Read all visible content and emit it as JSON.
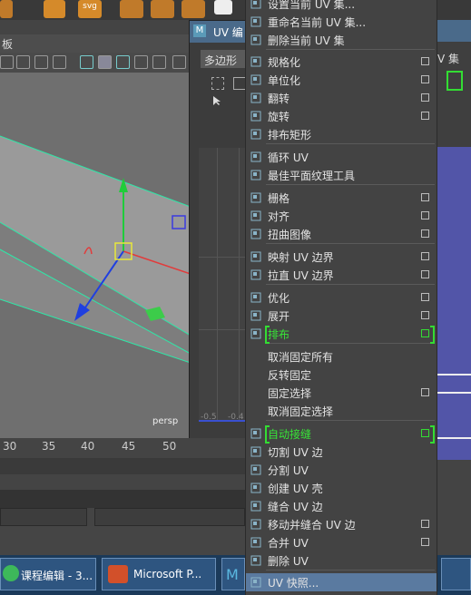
{
  "viewport": {
    "panel_label": "板",
    "camera_label": "persp",
    "timeline_ticks": [
      "30",
      "35",
      "40",
      "45",
      "50"
    ]
  },
  "uv_window": {
    "title": "UV 编",
    "tab_label": "多边形",
    "axis_labels": [
      "-0.5",
      "-0.4"
    ]
  },
  "right_panel": {
    "label": "V 集"
  },
  "menu": {
    "items": [
      {
        "label": "设置当前 UV 集...",
        "icon": "uv-set-icon",
        "check": false
      },
      {
        "label": "重命名当前 UV 集...",
        "icon": "rename-uv-icon",
        "check": false
      },
      {
        "label": "删除当前 UV 集",
        "icon": "delete-uv-icon",
        "check": false
      },
      {
        "label": "规格化",
        "icon": "normalize-icon",
        "check": true
      },
      {
        "label": "单位化",
        "icon": "unitize-icon",
        "check": true
      },
      {
        "label": "翻转",
        "icon": "flip-icon",
        "check": true
      },
      {
        "label": "旋转",
        "icon": "rotate-icon",
        "check": true
      },
      {
        "label": "排布矩形",
        "icon": "rect-layout-icon",
        "check": false
      },
      {
        "label": "循环 UV",
        "icon": "cycle-uv-icon",
        "check": false
      },
      {
        "label": "最佳平面纹理工具",
        "icon": "best-plane-icon",
        "check": false
      },
      {
        "label": "栅格",
        "icon": "grid-icon",
        "check": true
      },
      {
        "label": "对齐",
        "icon": "align-icon",
        "check": true
      },
      {
        "label": "扭曲图像",
        "icon": "warp-icon",
        "check": true
      },
      {
        "label": "映射 UV 边界",
        "icon": "map-border-icon",
        "check": true
      },
      {
        "label": "拉直 UV 边界",
        "icon": "straighten-border-icon",
        "check": true
      },
      {
        "label": "优化",
        "icon": "optimize-icon",
        "check": true
      },
      {
        "label": "展开",
        "icon": "unfold-icon",
        "check": true
      },
      {
        "label": "排布",
        "icon": "layout-icon",
        "check": true,
        "highlight": true
      },
      {
        "label": "取消固定所有",
        "icon": "",
        "check": false
      },
      {
        "label": "反转固定",
        "icon": "",
        "check": false
      },
      {
        "label": "固定选择",
        "icon": "",
        "check": true
      },
      {
        "label": "取消固定选择",
        "icon": "",
        "check": false
      },
      {
        "label": "自动接缝",
        "icon": "auto-seam-icon",
        "check": true,
        "highlight": true
      },
      {
        "label": "切割 UV 边",
        "icon": "cut-uv-icon",
        "check": false
      },
      {
        "label": "分割 UV",
        "icon": "split-uv-icon",
        "check": false
      },
      {
        "label": "创建 UV 壳",
        "icon": "create-shell-icon",
        "check": false
      },
      {
        "label": "缝合 UV 边",
        "icon": "sew-uv-icon",
        "check": false
      },
      {
        "label": "移动并缝合 UV 边",
        "icon": "move-sew-icon",
        "check": true
      },
      {
        "label": "合并 UV",
        "icon": "merge-uv-icon",
        "check": true
      },
      {
        "label": "删除 UV",
        "icon": "delete-icon",
        "check": false
      },
      {
        "label": "UV 快照...",
        "icon": "snapshot-icon",
        "check": false,
        "selected": true
      }
    ]
  },
  "taskbar": {
    "items": [
      "课程编辑 - 3...",
      "Microsoft P..."
    ]
  }
}
